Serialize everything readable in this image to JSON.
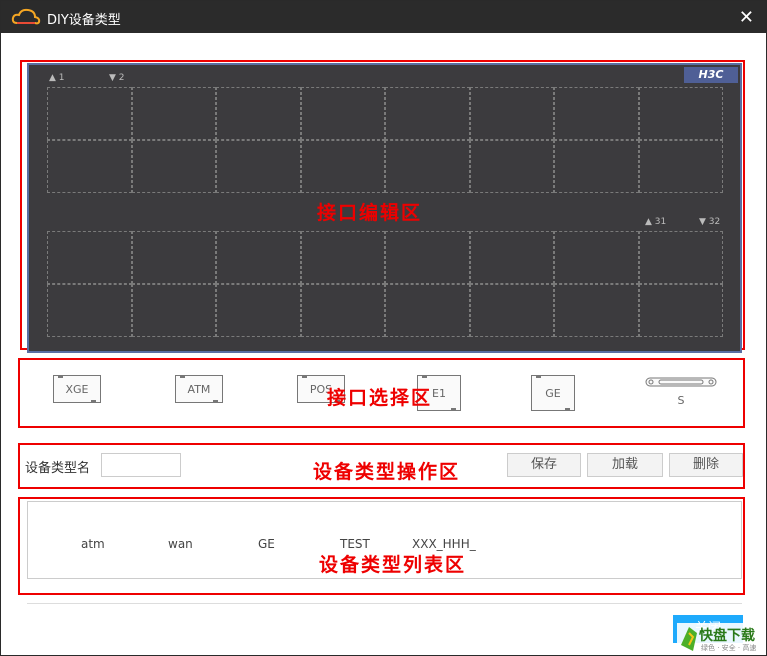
{
  "window": {
    "title": "DIY设备类型",
    "close_glyph": "✕"
  },
  "annotations": {
    "edit_area": "接口编辑区",
    "select_area": "接口选择区",
    "ops_area": "设备类型操作区",
    "list_area": "设备类型列表区"
  },
  "panel": {
    "brand": "H3C",
    "ports": {
      "p1": "1",
      "p2": "2",
      "p31": "31",
      "p32": "32"
    }
  },
  "port_types": [
    "XGE",
    "ATM",
    "POS",
    "E1",
    "GE",
    "S"
  ],
  "ops": {
    "name_label": "设备类型名",
    "name_value": "",
    "save": "保存",
    "load": "加载",
    "delete": "删除"
  },
  "device_list": [
    "atm",
    "wan",
    "GE",
    "TEST",
    "XXX_HHH_"
  ],
  "footer": {
    "close": "关闭"
  },
  "watermark": {
    "main": "快盘下载",
    "sub": "绿色 · 安全 · 高速"
  },
  "colors": {
    "title_bg": "#2b2b2b",
    "panel_bg": "#3c3b3e",
    "brand_bg": "#4f5f96",
    "annotation": "#e00000",
    "primary_button": "#1eaafc"
  }
}
